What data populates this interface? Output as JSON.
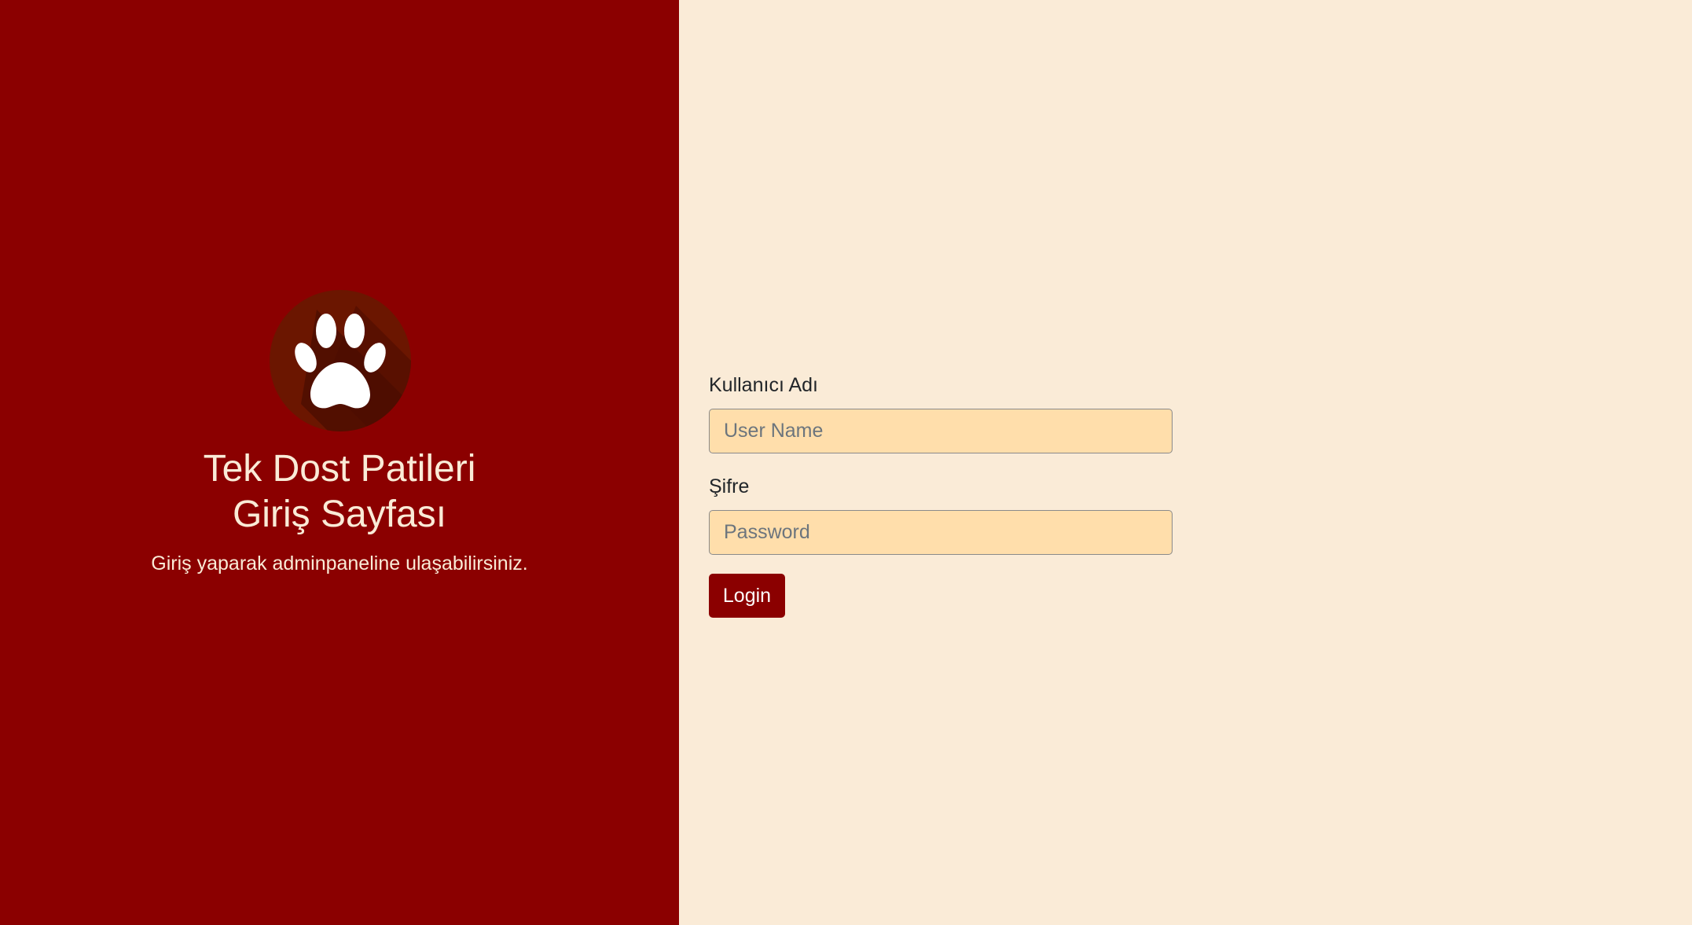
{
  "brand": {
    "logo_icon": "paw-icon",
    "title_line1": "Tek Dost Patileri",
    "title_line2": "Giriş Sayfası",
    "subtitle": "Giriş yaparak adminpaneline ulaşabilirsiniz."
  },
  "form": {
    "username": {
      "label": "Kullanıcı Adı",
      "placeholder": "User Name",
      "value": ""
    },
    "password": {
      "label": "Şifre",
      "placeholder": "Password",
      "value": ""
    },
    "login_label": "Login"
  },
  "colors": {
    "left_panel_bg": "#8b0000",
    "right_panel_bg": "#faebd7",
    "input_bg": "#ffdeab",
    "button_bg": "#8b0000",
    "logo_circle": "#6b1600"
  }
}
